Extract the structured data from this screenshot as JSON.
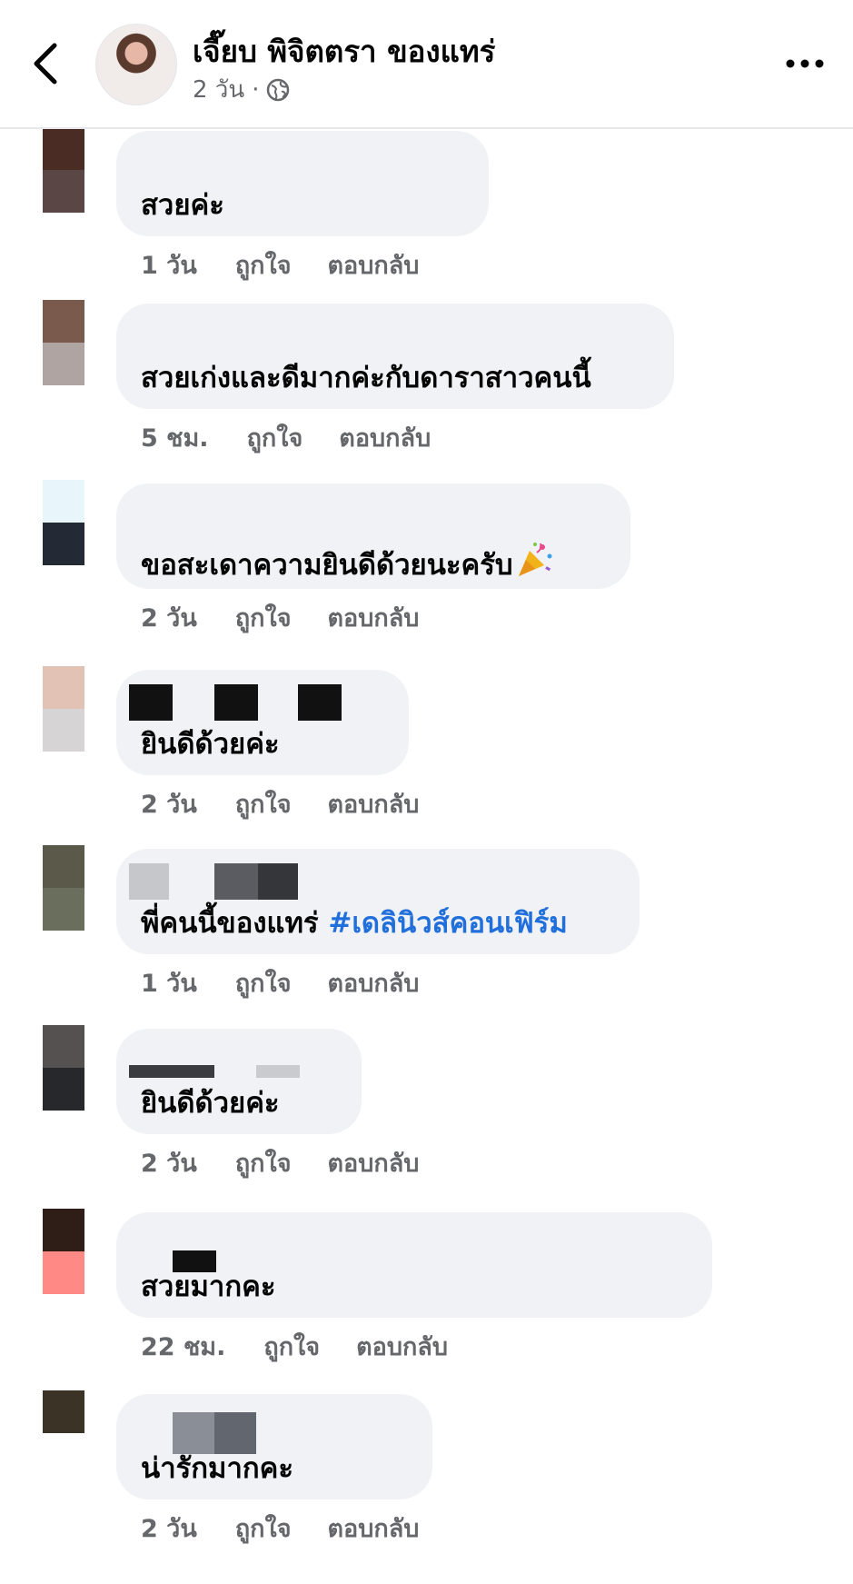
{
  "header": {
    "name": "เจี๊ยบ พิจิตตรา ของแทร่",
    "time": "2 วัน",
    "dot": "·",
    "privacy_icon": "globe-icon",
    "back_icon": "chevron-left-icon",
    "more_icon": "more-dots-icon"
  },
  "actions": {
    "like": "ถูกใจ",
    "reply": "ตอบกลับ"
  },
  "comments": [
    {
      "text": "สวยค่ะ",
      "time": "1 วัน"
    },
    {
      "text": "สวยเก่งและดีมากค่ะกับดาราสาวคนนี้",
      "time": "5 ชม."
    },
    {
      "text": "ขอสะเดาความยินดีด้วยนะครับ",
      "time": "2 วัน",
      "emoji": "party-popper-icon"
    },
    {
      "text": "ยินดีด้วยค่ะ",
      "time": "2 วัน"
    },
    {
      "text": "พี่คนนี้ของแทร่ ",
      "hashtag": "#เดลินิวส์คอนเฟิร์ม",
      "time": "1 วัน"
    },
    {
      "text": "ยินดีด้วยค่ะ",
      "time": "2 วัน"
    },
    {
      "text": "สวยมากคะ",
      "time": "22 ชม."
    },
    {
      "text": "น่ารักมากคะ",
      "time": "2 วัน"
    }
  ],
  "colors": {
    "bubble": "#f0f2f5",
    "secondary_text": "#65676b",
    "hashtag": "#216fdb",
    "avatars": [
      [
        "#4a2c25",
        "#5a4645"
      ],
      [
        "#7a5a4d",
        "#b0a4a2"
      ],
      [
        "#e8f6fb",
        "#232a35"
      ],
      [
        "#e2c2b5",
        "#d7d4d6"
      ],
      [
        "#5b5a4a",
        "#6a6e5d"
      ],
      [
        "#555150",
        "#26282c"
      ],
      [
        "#2e1e17",
        "#ff8a85"
      ],
      [
        "#3b3325",
        "#ffffff"
      ]
    ]
  }
}
